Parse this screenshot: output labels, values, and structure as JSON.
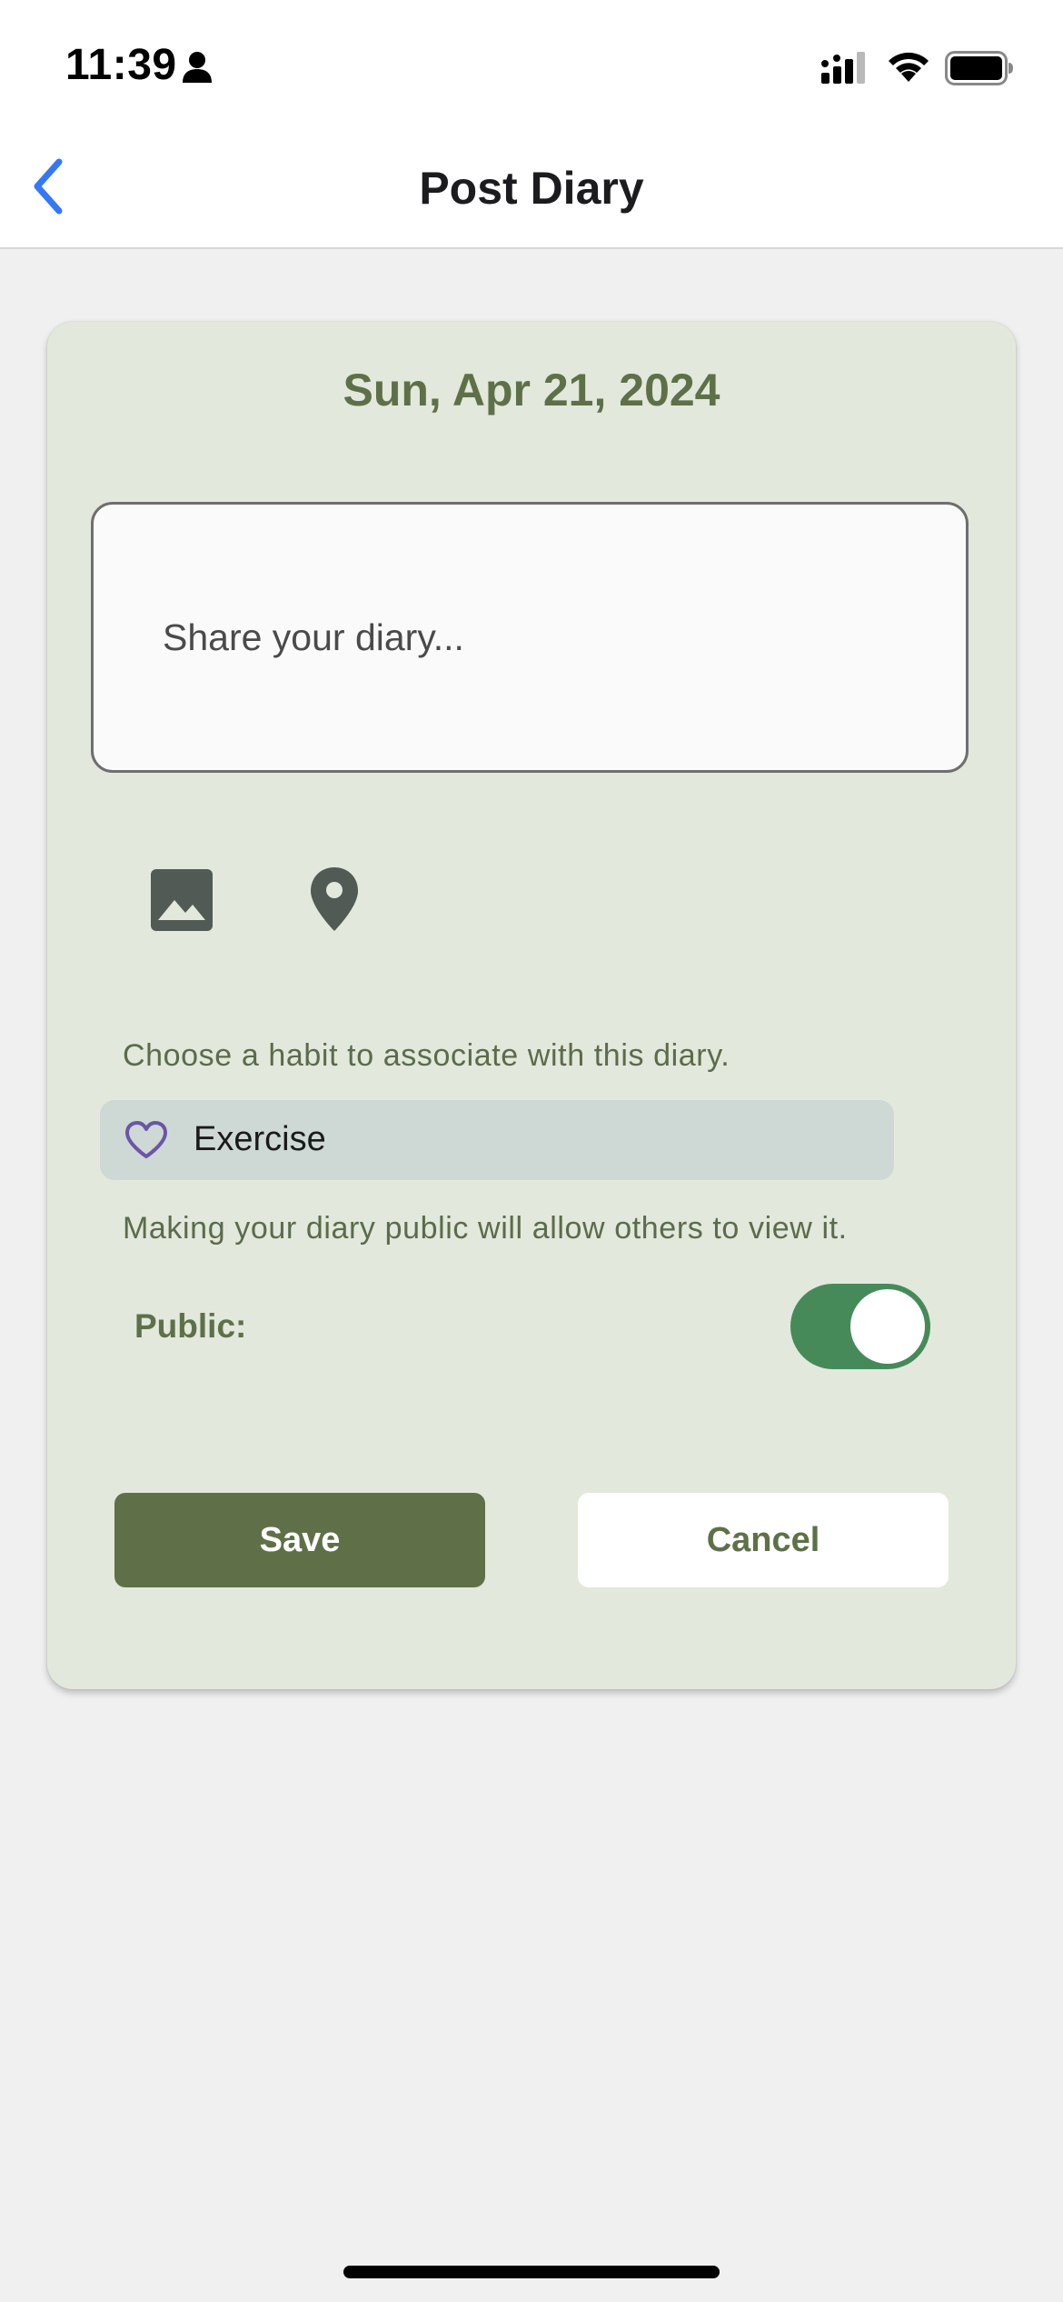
{
  "status_bar": {
    "time": "11:39",
    "icons": [
      "person-icon",
      "signal-icon",
      "wifi-icon",
      "battery-icon"
    ]
  },
  "nav": {
    "back_icon": "chevron-left-icon",
    "title": "Post Diary"
  },
  "diary_form": {
    "date": "Sun, Apr 21, 2024",
    "diary_placeholder": "Share your diary...",
    "diary_value": "",
    "attachment_icons": [
      "image-icon",
      "location-pin-icon"
    ],
    "habit_hint": "Choose a habit to associate with this diary.",
    "habit": {
      "icon": "heart-icon",
      "label": "Exercise"
    },
    "public_hint": "Making your diary public will allow others to view it.",
    "public_label": "Public:",
    "public_enabled": true,
    "save_label": "Save",
    "cancel_label": "Cancel"
  },
  "colors": {
    "accent_blue": "#3478f6",
    "card_background": "#e2e8dc",
    "primary_green": "#5f7049",
    "toggle_green": "#468a5a",
    "heart_purple": "#6b55a6",
    "chip_background": "#ced8d5"
  }
}
